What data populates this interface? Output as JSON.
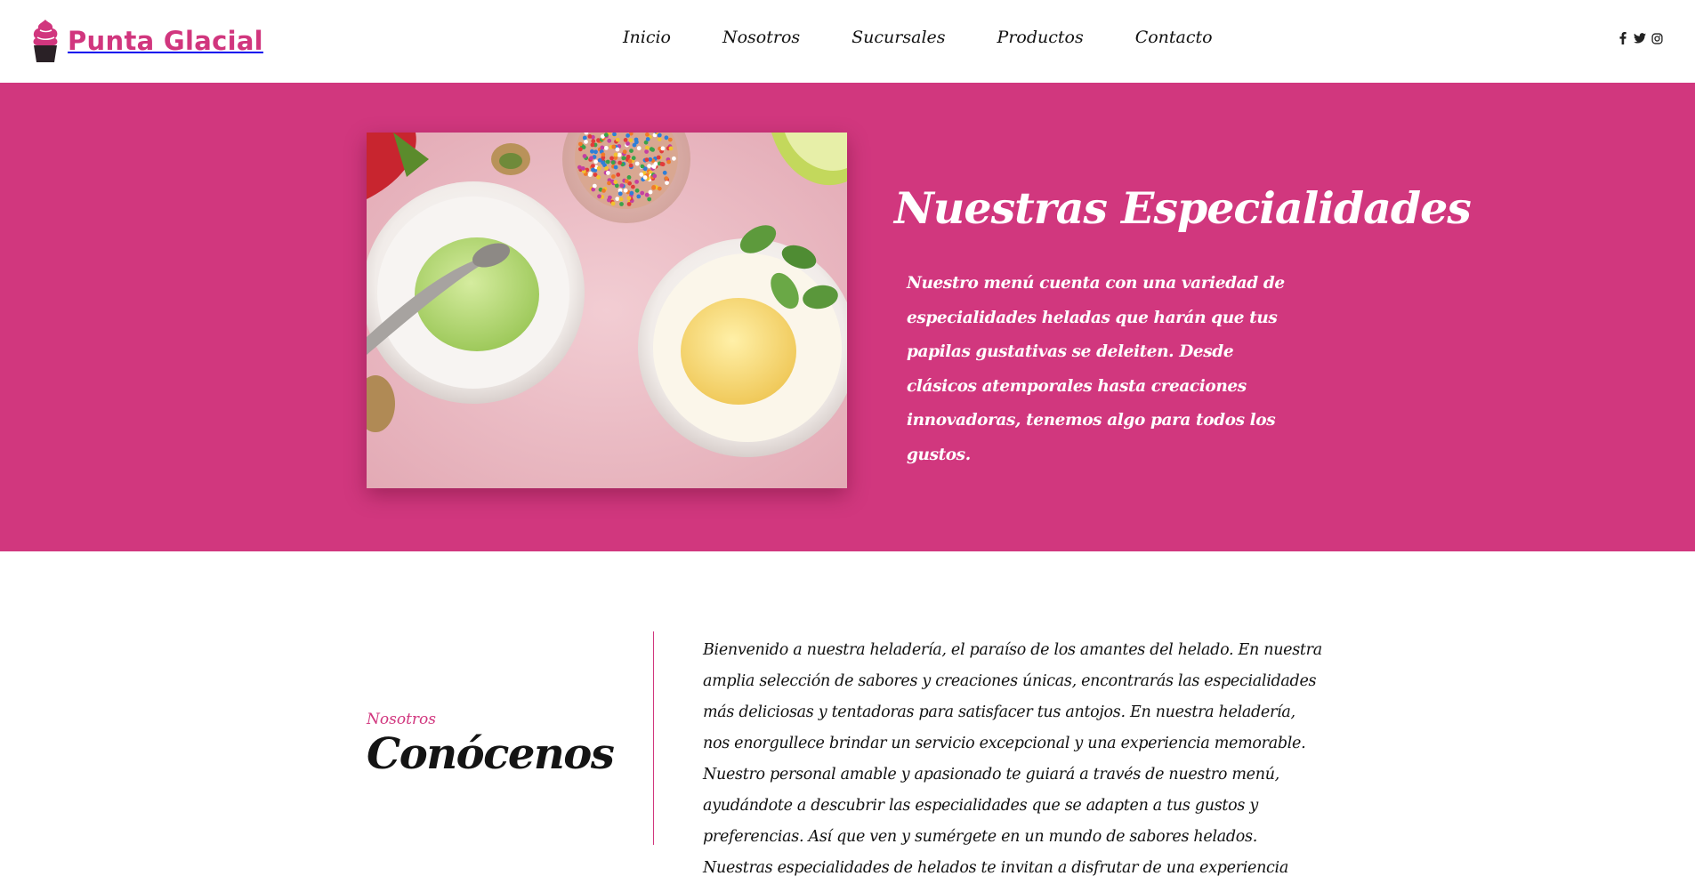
{
  "brand": {
    "name": "Punta Glacial",
    "accent": "#d1367e",
    "hero_bg": "#d1377e"
  },
  "nav": {
    "items": [
      "Inicio",
      "Nosotros",
      "Sucursales",
      "Productos",
      "Contacto"
    ]
  },
  "social": {
    "icons": [
      "facebook-icon",
      "twitter-icon",
      "instagram-icon"
    ]
  },
  "hero": {
    "title": "Nuestras Especialidades",
    "text": "Nuestro menú cuenta con una variedad de especialidades heladas que harán que tus papilas gustativas se deleiten. Desde clásicos atemporales hasta creaciones innovadoras, tenemos algo para todos los gustos."
  },
  "about": {
    "kicker": "Nosotros",
    "title": "Conócenos",
    "text": "Bienvenido a nuestra heladería, el paraíso de los amantes del helado. En nuestra amplia selección de sabores y creaciones únicas, encontrarás las especialidades más deliciosas y tentadoras para satisfacer tus antojos. En nuestra heladería, nos enorgullece brindar un servicio excepcional y una experiencia memorable. Nuestro personal amable y apasionado te guiará a través de nuestro menú, ayudándote a descubrir las especialidades que se adapten a tus gustos y preferencias. Así que ven y sumérgete en un mundo de sabores helados. Nuestras especialidades de helados te invitan a disfrutar de una experiencia"
  }
}
